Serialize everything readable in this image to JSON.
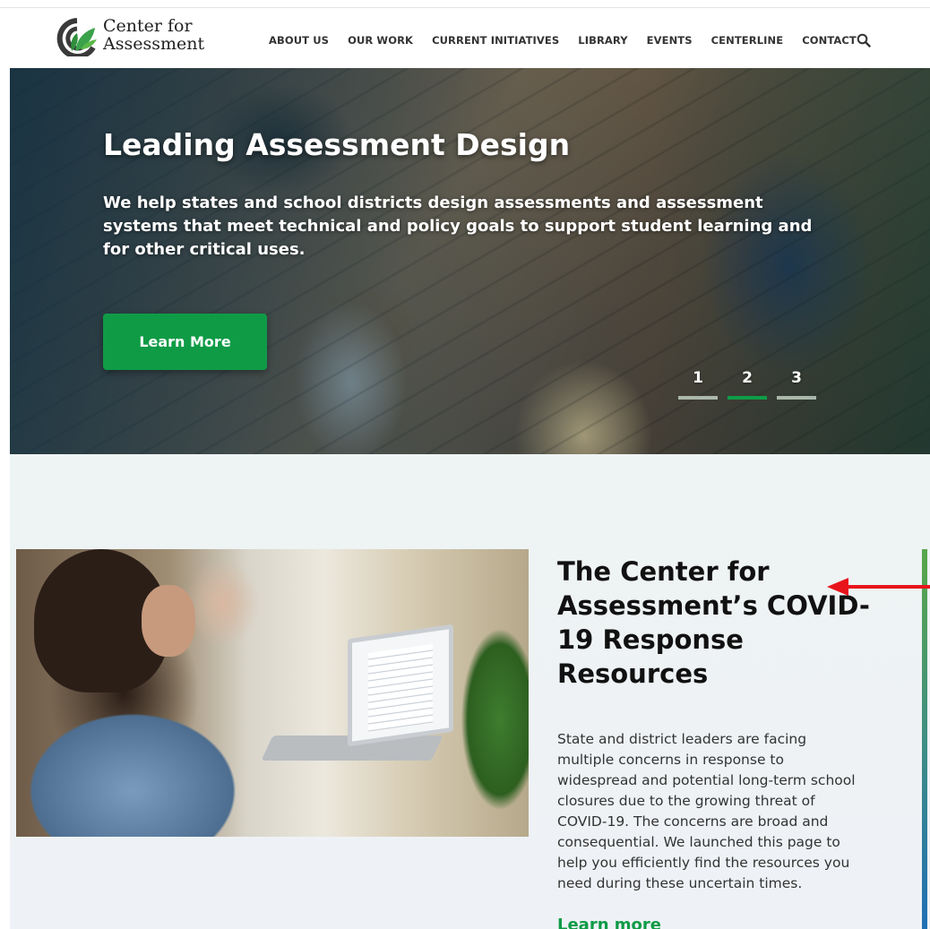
{
  "brand": {
    "name_line1": "Center for",
    "name_line2": "Assessment",
    "colors": {
      "primary_green": "#0f9b46",
      "logo_dark": "#3a3a3a",
      "accent_blue": "#1f6fb5"
    }
  },
  "nav": {
    "items": [
      "ABOUT US",
      "OUR WORK",
      "CURRENT INITIATIVES",
      "LIBRARY",
      "EVENTS",
      "CENTERLINE",
      "CONTACT"
    ],
    "search_icon": "search-icon"
  },
  "hero": {
    "title": "Leading Assessment Design",
    "text": "We help states and school districts design assessments and assessment systems that meet technical and policy goals to support student learning and for other critical uses.",
    "button": "Learn More",
    "slides": [
      "1",
      "2",
      "3"
    ],
    "active_slide": 2
  },
  "feature": {
    "title": "The Center for Assessment’s COVID-19 Response Resources",
    "text": "State and district leaders are facing multiple concerns in response to widespread and potential long-term school closures due to the growing threat of COVID-19. The concerns are broad and consequential. We launched this page to help you efficiently find the resources you need during these uncertain times.",
    "link": "Learn more"
  },
  "annotation": {
    "arrow_color": "#e8141b"
  }
}
